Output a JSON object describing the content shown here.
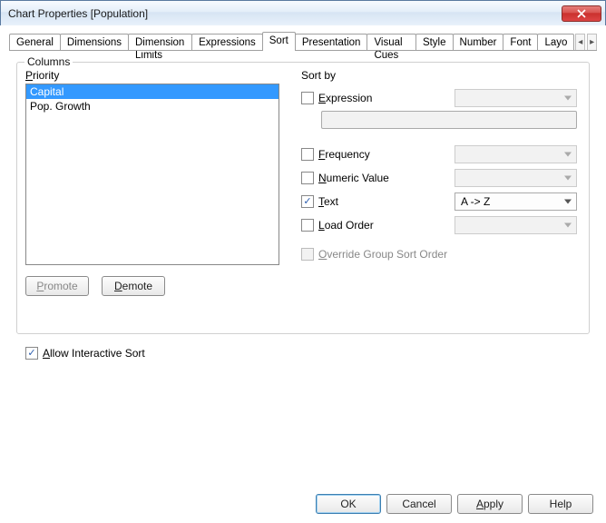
{
  "title": "Chart Properties [Population]",
  "tabs": {
    "general": "General",
    "dimensions": "Dimensions",
    "dimension_limits": "Dimension Limits",
    "expressions": "Expressions",
    "sort": "Sort",
    "presentation": "Presentation",
    "visual_cues": "Visual Cues",
    "style": "Style",
    "number": "Number",
    "font": "Font",
    "layout_trunc": "Layo"
  },
  "columns": {
    "legend": "Columns",
    "priority_label": "Priority",
    "items": [
      "Capital",
      "Pop. Growth"
    ],
    "promote": "Promote",
    "demote": "Demote"
  },
  "sortby": {
    "legend": "Sort by",
    "expression": "Expression",
    "frequency": "Frequency",
    "numeric": "Numeric Value",
    "text": "Text",
    "text_value": "A -> Z",
    "load_order": "Load Order",
    "override": "Override Group Sort Order"
  },
  "allow_interactive": "Allow Interactive Sort",
  "buttons": {
    "ok": "OK",
    "cancel": "Cancel",
    "apply": "Apply",
    "help": "Help"
  }
}
